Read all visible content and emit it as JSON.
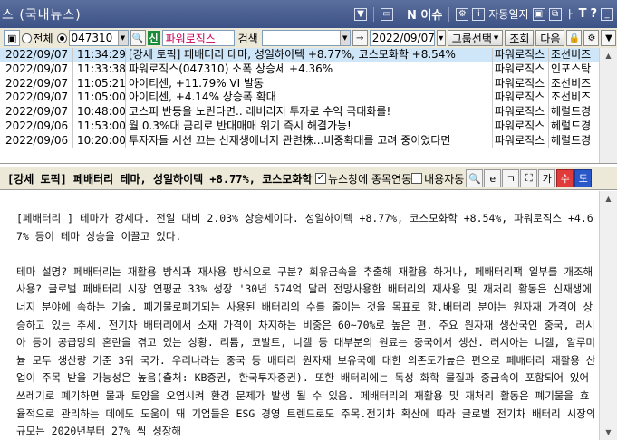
{
  "window": {
    "title": "스 (국내뉴스)",
    "toolbar_icons": [
      "arrow-down-icon",
      "minimize-icon"
    ],
    "news_label": "N 이슈",
    "auto_label": "자동일지",
    "font_sizes": [
      "ㅏ",
      "T",
      "?"
    ]
  },
  "toolbar": {
    "radio_all": "전체",
    "stock_code": "047310",
    "shin_badge": "신",
    "stock_name": "파워로직스",
    "search_label": "검색",
    "search_value": "",
    "date": "2022/09/07",
    "group_select": "그룹선택",
    "query_button": "조회",
    "next_button": "다음"
  },
  "news": [
    {
      "date": "2022/09/07",
      "time": "11:34:29",
      "title": "[강세 토픽] 페배터리  테마, 성일하이텍 +8.77%, 코스모화학 +8.54%",
      "code": "파워로직스",
      "source": "조선비즈",
      "selected": true
    },
    {
      "date": "2022/09/07",
      "time": "11:33:38",
      "title": "파워로직스(047310) 소폭 상승세 +4.36%",
      "code": "파워로직스",
      "source": "인포스탁",
      "selected": false
    },
    {
      "date": "2022/09/07",
      "time": "11:05:21",
      "title": "아이티센, +11.79% VI 발동",
      "code": "파워로직스",
      "source": "조선비즈",
      "selected": false
    },
    {
      "date": "2022/09/07",
      "time": "11:05:00",
      "title": "아이티센, +4.14% 상승폭 확대",
      "code": "파워로직스",
      "source": "조선비즈",
      "selected": false
    },
    {
      "date": "2022/09/07",
      "time": "10:48:00",
      "title": "코스피 반등을 노린다면.. 레버리지 투자로 수익 극대화를!",
      "code": "파워로직스",
      "source": "헤럴드경",
      "selected": false
    },
    {
      "date": "2022/09/06",
      "time": "11:53:00",
      "title": "월 0.3%대 금리로 반대매매 위기 즉시 해결가능!",
      "code": "파워로직스",
      "source": "헤럴드경",
      "selected": false
    },
    {
      "date": "2022/09/06",
      "time": "10:20:00",
      "title": "투자자들 시선 끄는 신재생에너지 관련株...비중확대를 고려 중이었다면",
      "code": "파워로직스",
      "source": "헤럴드경",
      "selected": false
    }
  ],
  "detail": {
    "title": "[강세 토픽] 페배터리  테마, 성일하이텍 +8.77%, 코스모화학 +8.54%, 파워로직스 +4.67%",
    "chk_link": "뉴스창에 종목연동",
    "chk_auto": "내용자동",
    "icon_blue": "도",
    "icon_red": "수",
    "paragraphs": [
      "[페배터리 ] 테마가 강세다. 전일 대비 2.03% 상승세이다. 성일하이텍 +8.77%, 코스모화학 +8.54%, 파워로직스 +4.67% 등이 테마 상승을 이끌고 있다.",
      "테마 설명? 페배터리는 재활용 방식과 재사용 방식으로 구분? 회유금속을 추출해 재활용 하거나, 페배터리팩 일부를 개조해 사용? 글로벌 페배터리 시장 연평균 33% 성장 '30년 574억 달러 전망사용한 배터리의 재사용 및 재처리 활동은 신재생에너지 분야에 속하는 기술. 폐기물로폐기되는 사용된 배터리의 수를 줄이는 것을 목표로 함.배터리 분야는 원자재 가격이 상승하고 있는 추세. 전기차 배터리에서 소재 가격이 차지하는 비중은 60~70%로 높은 편. 주요 원자재 생산국인 중국, 러시아 등이 공급망의 혼란을 겪고 있는 상황. 리튬, 코발트, 니켈 등 대부분의 원료는 중국에서 생산. 러시아는 니켈, 알루미늄 모두 생산량 기준 3위 국가. 우리나라는 중국 등 배터리 원자재 보유국에 대한 의존도가높은 편으로 페배터리 재활용 산업이 주목 받을 가능성은 높음(출처: KB증권, 한국투자증권). 또한 배터리에는 독성 화학 물질과 중금속이 포함되어 있어 쓰레기로 폐기하면 물과 토양을 오염시켜 환경 문제가 발생 될 수 있음. 페배터리의 재활용 및 재처리 활동은 폐기물을 효율적으로 관리하는 데에도 도움이 돼 기업들은 ESG 경영 트렌드로도 주목.전기차 확산에 따라 글로벌 전기차 배터리 시장의 규모는 2020년부터 27% 씩 성장해"
    ]
  }
}
